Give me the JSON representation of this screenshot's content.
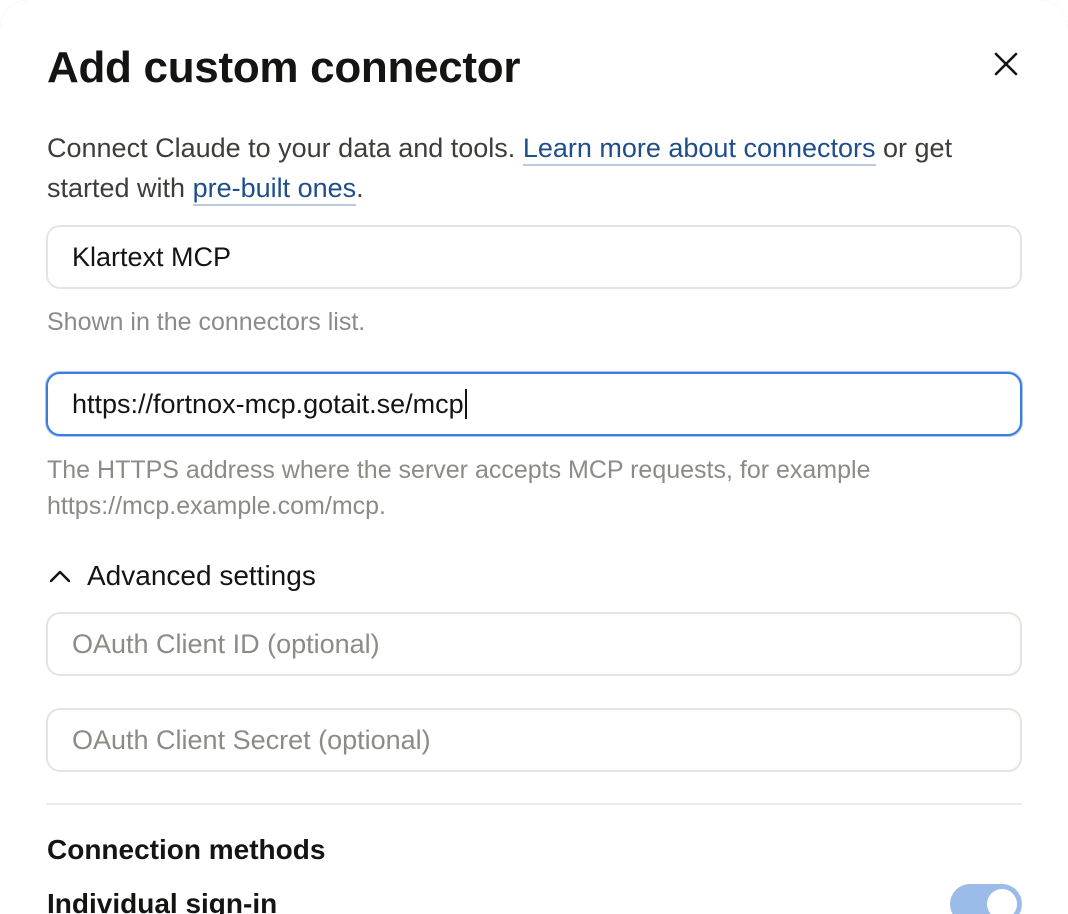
{
  "dialog": {
    "title": "Add custom connector",
    "intro_text_1": "Connect Claude to your data and tools. ",
    "learn_more_link": "Learn more about connectors",
    "intro_text_2": " or get started with ",
    "prebuilt_link": "pre-built ones",
    "intro_text_3": "."
  },
  "fields": {
    "name": {
      "value": "Klartext MCP",
      "hint": "Shown in the connectors list."
    },
    "url": {
      "value": "https://fortnox-mcp.gotait.se/mcp",
      "hint": "The HTTPS address where the server accepts MCP requests, for example https://mcp.example.com/mcp."
    }
  },
  "advanced": {
    "label": "Advanced settings",
    "expanded": true,
    "client_id_placeholder": "OAuth Client ID (optional)",
    "client_secret_placeholder": "OAuth Client Secret (optional)"
  },
  "connection_methods": {
    "title": "Connection methods",
    "individual_signin_label": "Individual sign-in",
    "individual_signin_enabled": true
  },
  "colors": {
    "link": "#1f4e8c",
    "focus_ring": "#3b7ddd",
    "toggle_on": "#9bbbe8"
  }
}
